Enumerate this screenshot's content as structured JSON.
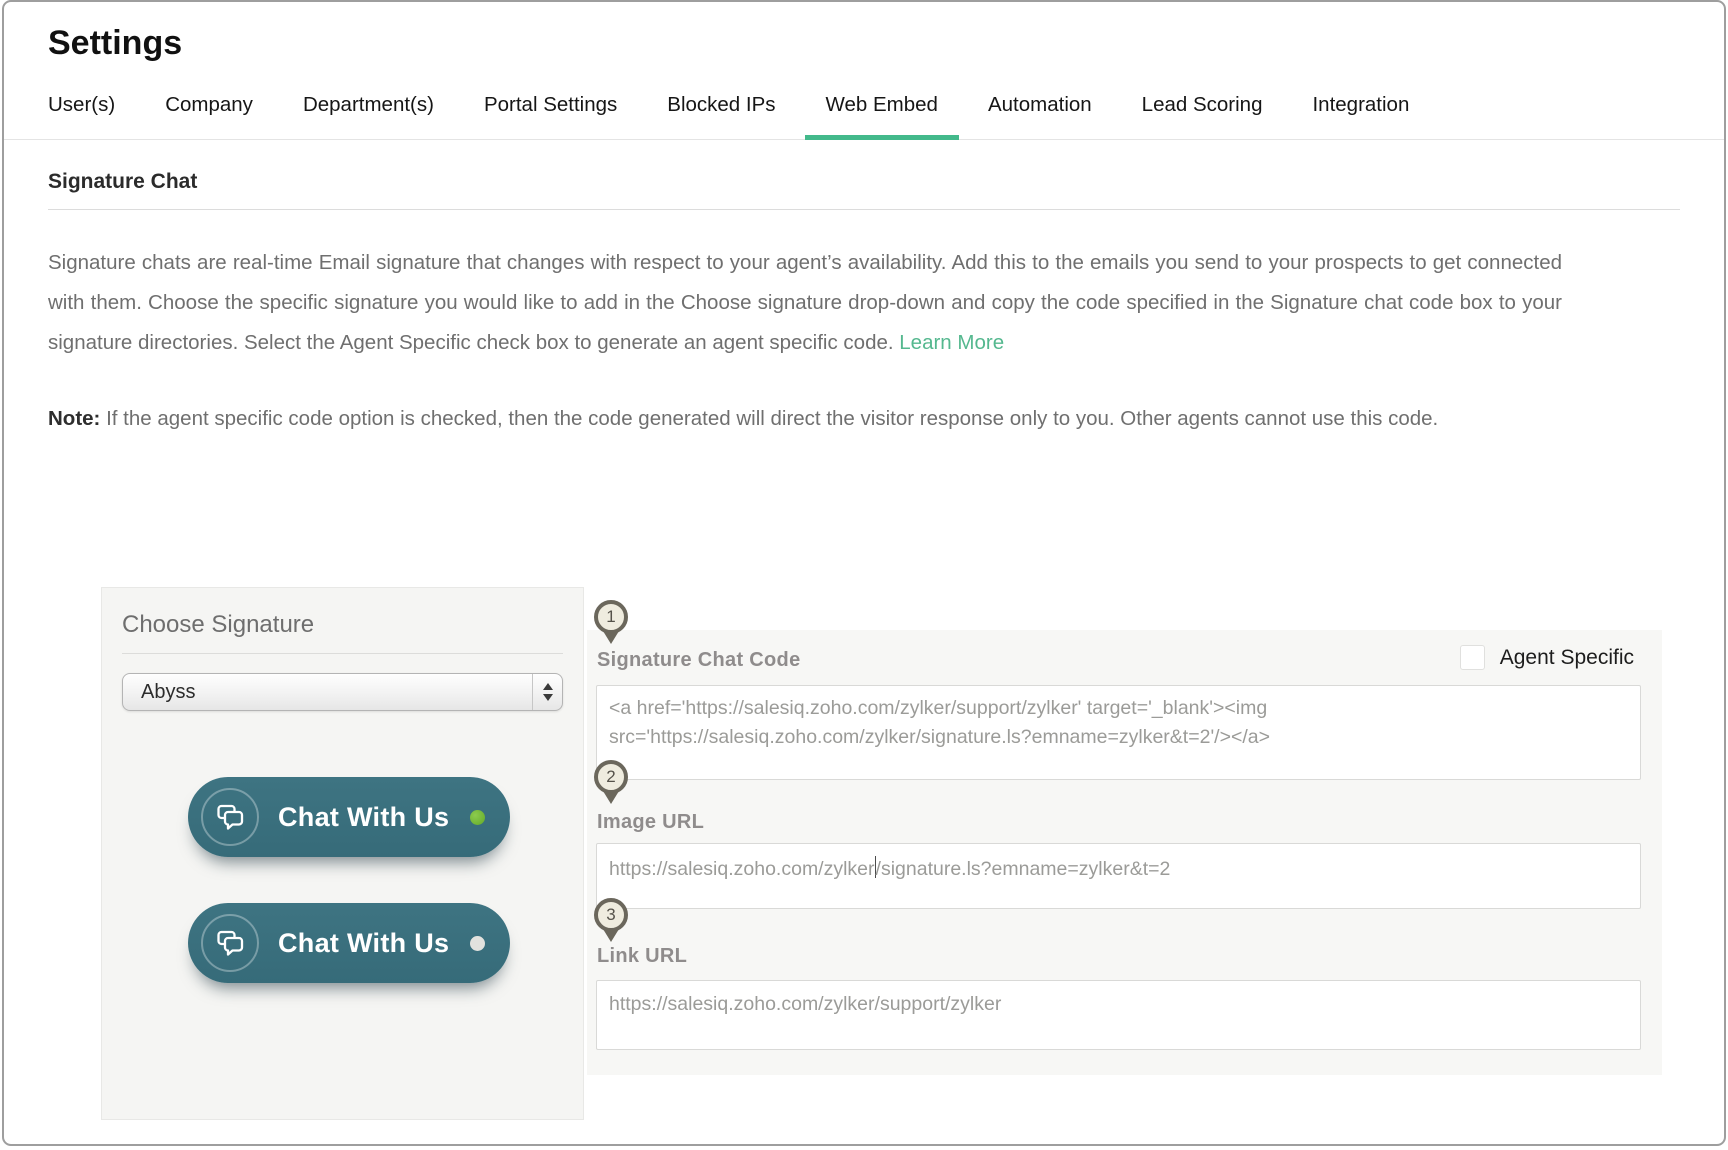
{
  "window": {
    "title": "Settings"
  },
  "tabs": [
    {
      "label": "User(s)",
      "active": false
    },
    {
      "label": "Company",
      "active": false
    },
    {
      "label": "Department(s)",
      "active": false
    },
    {
      "label": "Portal Settings",
      "active": false
    },
    {
      "label": "Blocked IPs",
      "active": false
    },
    {
      "label": "Web Embed",
      "active": true
    },
    {
      "label": "Automation",
      "active": false
    },
    {
      "label": "Lead Scoring",
      "active": false
    },
    {
      "label": "Integration",
      "active": false
    }
  ],
  "section": {
    "title": "Signature Chat"
  },
  "description": {
    "text": "Signature chats are real-time Email signature that changes with respect to your agent’s availability. Add this to the emails you send to your prospects to get connected with them. Choose the specific signature you would like to add in the Choose signature drop-down and copy the code specified in the Signature chat code box to your signature directories. Select the Agent Specific check box to generate an agent specific code.",
    "link_label": "Learn More"
  },
  "note": {
    "label": "Note:",
    "text": "If the agent specific code option is checked, then the code generated will direct the visitor response only to you. Other agents cannot use this code."
  },
  "markers": [
    "1",
    "2",
    "3"
  ],
  "choose_signature": {
    "title": "Choose Signature",
    "selected": "Abyss",
    "previews": [
      {
        "label": "Chat With Us",
        "status": "online",
        "status_color": "#63aa28"
      },
      {
        "label": "Chat With Us",
        "status": "offline",
        "status_color": "#e2e2de"
      }
    ]
  },
  "code_section": {
    "signature_chat_code": {
      "label": "Signature Chat Code",
      "value": "<a href='https://salesiq.zoho.com/zylker/support/zylker' target='_blank'><img src='https://salesiq.zoho.com/zylker/signature.ls?emname=zylker&t=2'/></a>"
    },
    "agent_specific": {
      "label": "Agent Specific",
      "checked": false
    },
    "image_url": {
      "label": "Image URL",
      "value_pre_caret": "https://salesiq.zoho.com/zylker",
      "value_post_caret": "/signature.ls?emname=zylker&t=2"
    },
    "link_url": {
      "label": "Link URL",
      "value": "https://salesiq.zoho.com/zylker/support/zylker"
    }
  },
  "colors": {
    "accent_green": "#43b98b",
    "link_green": "#55b88f",
    "pill_teal": "#3a6e7c",
    "online_dot": "#63aa28",
    "pin_brown": "#6b675c"
  }
}
